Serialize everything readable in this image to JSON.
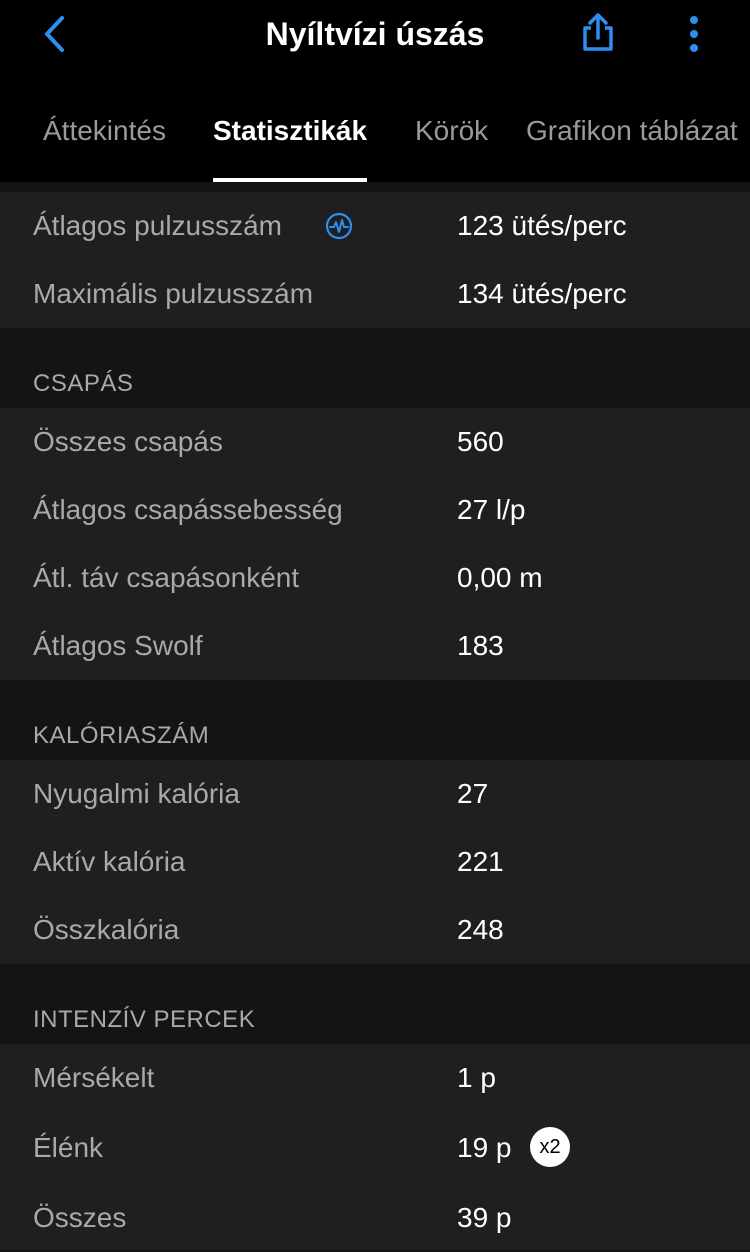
{
  "header": {
    "title": "Nyíltvízi úszás",
    "back_icon": "chevron-left-icon",
    "share_icon": "share-icon",
    "more_icon": "more-vertical-icon",
    "accent_color": "#2f8ff0"
  },
  "tabs": [
    {
      "label": "Áttekintés",
      "active": false
    },
    {
      "label": "Statisztikák",
      "active": true
    },
    {
      "label": "Körök",
      "active": false
    },
    {
      "label": "Grafikon táblázat",
      "active": false
    }
  ],
  "heart_rate": {
    "rows": [
      {
        "label": "Átlagos pulzusszám",
        "value": "123 ütés/perc",
        "icon": "heart-rate-icon"
      },
      {
        "label": "Maximális pulzusszám",
        "value": "134 ütés/perc"
      }
    ]
  },
  "stroke": {
    "header": "CSAPÁS",
    "rows": [
      {
        "label": "Összes csapás",
        "value": "560"
      },
      {
        "label": "Átlagos csapássebesség",
        "value": "27 l/p"
      },
      {
        "label": "Átl. táv csapásonként",
        "value": "0,00 m"
      },
      {
        "label": "Átlagos Swolf",
        "value": "183"
      }
    ]
  },
  "calories": {
    "header": "KALÓRIASZÁM",
    "rows": [
      {
        "label": "Nyugalmi kalória",
        "value": "27"
      },
      {
        "label": "Aktív kalória",
        "value": "221"
      },
      {
        "label": "Összkalória",
        "value": "248"
      }
    ]
  },
  "intensity": {
    "header": "INTENZÍV PERCEK",
    "rows": [
      {
        "label": "Mérsékelt",
        "value": "1 p"
      },
      {
        "label": "Élénk",
        "value": "19 p",
        "badge": "x2"
      },
      {
        "label": "Összes",
        "value": "39 p"
      }
    ]
  }
}
